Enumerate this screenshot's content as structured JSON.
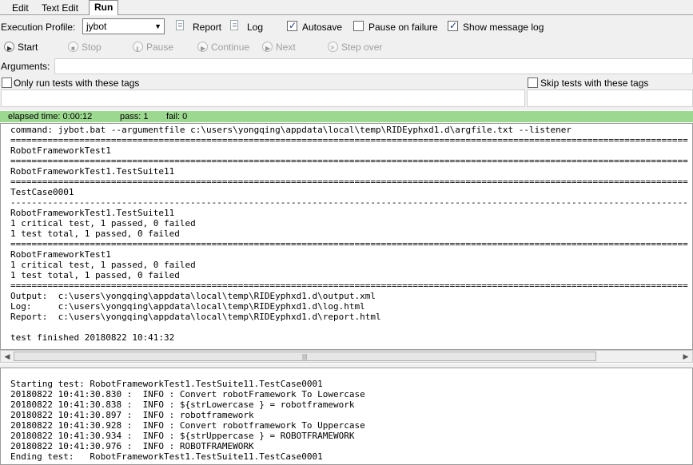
{
  "tabs": [
    "Edit",
    "Text Edit",
    "Run"
  ],
  "active_tab": "Run",
  "profile": {
    "label": "Execution Profile:",
    "selected": "jybot",
    "report_label": "Report",
    "log_label": "Log",
    "autosave_label": "Autosave",
    "autosave_checked": true,
    "pause_on_failure_label": "Pause on failure",
    "pause_on_failure_checked": false,
    "show_message_log_label": "Show message log",
    "show_message_log_checked": true
  },
  "run_buttons": {
    "start": "Start",
    "stop": "Stop",
    "pause": "Pause",
    "continue": "Continue",
    "next": "Next",
    "step_over": "Step over"
  },
  "arguments": {
    "label": "Arguments:",
    "value": ""
  },
  "tags": {
    "only_run_label": "Only run tests with these tags",
    "skip_label": "Skip tests with these tags",
    "only_run_value": "",
    "skip_value": ""
  },
  "status": {
    "elapsed": "elapsed time: 0:00:12",
    "pass": "pass: 1",
    "fail": "fail: 0",
    "color": "#9cd890"
  },
  "console_lines": [
    "command: jybot.bat --argumentfile c:\\users\\yongqing\\appdata\\local\\temp\\RIDEyphxd1.d\\argfile.txt --listener",
    "================================================================================================================================",
    "RobotFrameworkTest1",
    "================================================================================================================================",
    "RobotFrameworkTest1.TestSuite11",
    "================================================================================================================================",
    "TestCase0001",
    "--------------------------------------------------------------------------------------------------------------------------------",
    "RobotFrameworkTest1.TestSuite11",
    "1 critical test, 1 passed, 0 failed",
    "1 test total, 1 passed, 0 failed",
    "================================================================================================================================",
    "RobotFrameworkTest1",
    "1 critical test, 1 passed, 0 failed",
    "1 test total, 1 passed, 0 failed",
    "================================================================================================================================",
    "Output:  c:\\users\\yongqing\\appdata\\local\\temp\\RIDEyphxd1.d\\output.xml",
    "Log:     c:\\users\\yongqing\\appdata\\local\\temp\\RIDEyphxd1.d\\log.html",
    "Report:  c:\\users\\yongqing\\appdata\\local\\temp\\RIDEyphxd1.d\\report.html",
    "",
    "test finished 20180822 10:41:32"
  ],
  "message_log_lines": [
    "Starting test: RobotFrameworkTest1.TestSuite11.TestCase0001",
    "20180822 10:41:30.830 :  INFO : Convert robotFramework To Lowercase",
    "20180822 10:41:30.838 :  INFO : ${strLowercase } = robotframework",
    "20180822 10:41:30.897 :  INFO : robotframework",
    "20180822 10:41:30.928 :  INFO : Convert robotframework To Uppercase",
    "20180822 10:41:30.934 :  INFO : ${strUppercase } = ROBOTFRAMEWORK",
    "20180822 10:41:30.976 :  INFO : ROBOTFRAMEWORK",
    "Ending test:   RobotFrameworkTest1.TestSuite11.TestCase0001"
  ],
  "scroll_grip": "|||"
}
